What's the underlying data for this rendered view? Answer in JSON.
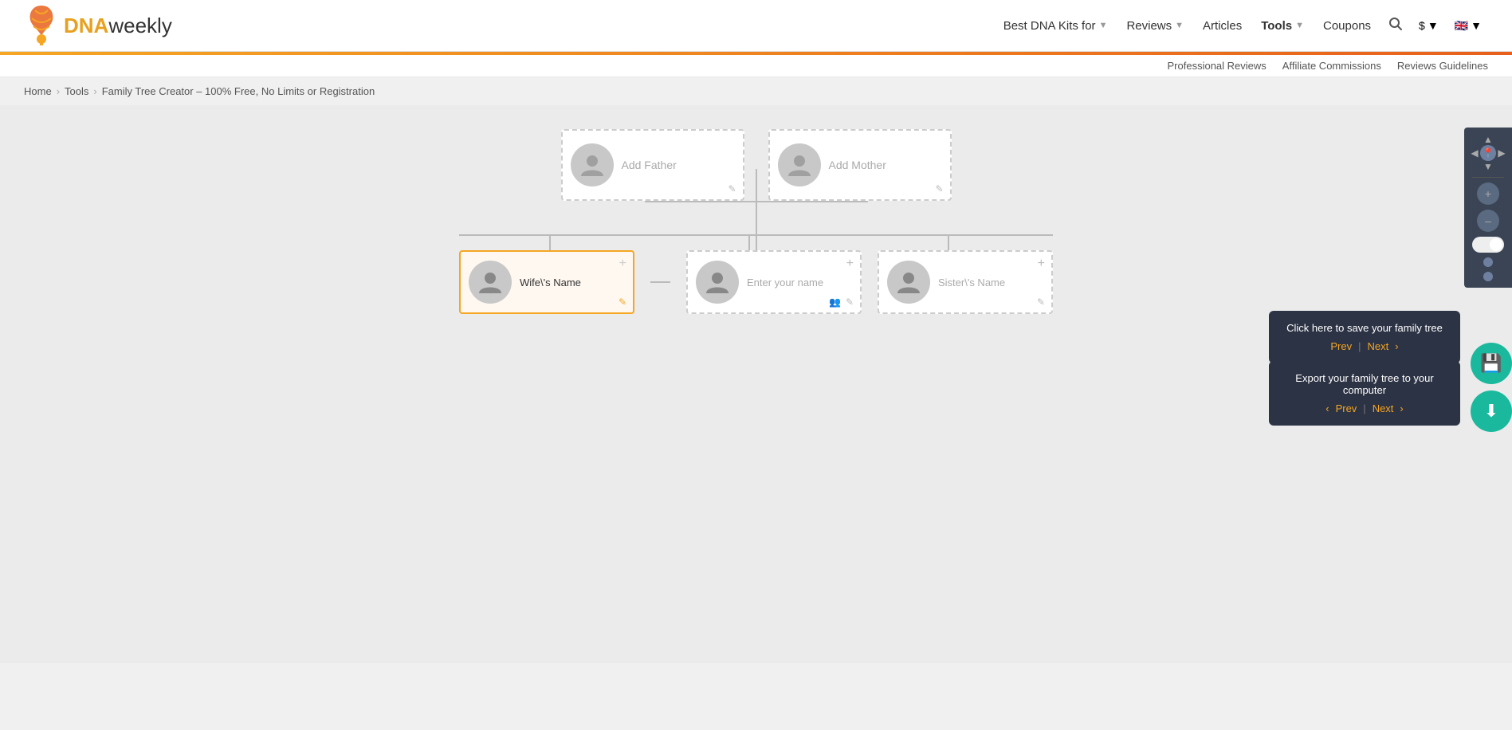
{
  "header": {
    "logo_dna": "DNA",
    "logo_weekly": "weekly",
    "nav": [
      {
        "label": "Best DNA Kits for",
        "hasDropdown": true,
        "bold": false
      },
      {
        "label": "Reviews",
        "hasDropdown": true,
        "bold": false
      },
      {
        "label": "Articles",
        "hasDropdown": false,
        "bold": false
      },
      {
        "label": "Tools",
        "hasDropdown": true,
        "bold": true
      },
      {
        "label": "Coupons",
        "hasDropdown": false,
        "bold": false
      }
    ],
    "currency": "$",
    "lang": "🇬🇧"
  },
  "subnav": {
    "professional_reviews": "Professional Reviews",
    "affiliate_commissions": "Affiliate Commissions",
    "reviews_guidelines": "Reviews Guidelines"
  },
  "breadcrumb": {
    "home": "Home",
    "tools": "Tools",
    "current": "Family Tree Creator – 100% Free, No Limits or Registration"
  },
  "sidebar": {
    "label": "Wife\\'s Name"
  },
  "tree": {
    "father_placeholder": "Add Father",
    "mother_placeholder": "Add Mother",
    "nodes": [
      {
        "id": "wife",
        "name": "Wife\\'s Name",
        "selected": true
      },
      {
        "id": "self",
        "name": "Enter your name",
        "selected": false
      },
      {
        "id": "sister",
        "name": "Sister\\'s Name",
        "selected": false
      }
    ]
  },
  "tooltip1": {
    "text": "Click here to save your family tree",
    "prev": "Prev",
    "next": "Next"
  },
  "tooltip2": {
    "text": "Export your family tree to your computer",
    "prev": "Prev",
    "next": "Next"
  },
  "right_panel": {
    "save_icon": "💾",
    "download_icon": "⬇"
  }
}
